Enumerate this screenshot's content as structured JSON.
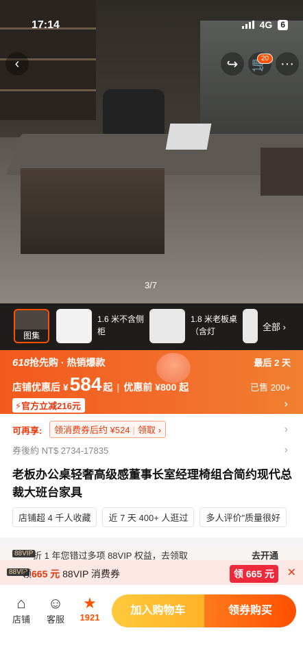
{
  "status": {
    "time": "17:14",
    "network": "4G",
    "battery": "6"
  },
  "header": {
    "cart_count": "20"
  },
  "gallery": {
    "indicator": "3/7"
  },
  "thumbnails": [
    {
      "label": "图集"
    },
    {
      "label": "1.6 米不含侧柜"
    },
    {
      "label": "1.8 米老板桌（含灯"
    },
    {
      "label": ""
    }
  ],
  "all_label": "全部",
  "promo": {
    "event": "618",
    "event_text": "抢先购 · 热销爆款",
    "last_days": "最后 2 天",
    "price_prefix": "店铺优惠后 ¥",
    "price": "584",
    "price_suffix": "起",
    "before": "优惠前 ¥800 起",
    "sold": "已售 200+",
    "official": "官方立减216元"
  },
  "coupon": {
    "again_label": "可再享:",
    "coupon_text": "领消费券后约 ¥524",
    "claim": "领取",
    "nt_price": "券後約 NT$ 2734-17835"
  },
  "product": {
    "title": "老板办公桌轻奢高级感董事长室经理椅组合简约现代总裁大班台家具",
    "tags": [
      "店铺超 4 千人收藏",
      "近 7 天 400+ 人逛过",
      "多人评价\"质量很好"
    ]
  },
  "vip_row": {
    "tag": "88VIP",
    "text": "折 1 年您错过多项 88VIP 权益，去领取",
    "action": "去开通"
  },
  "vip_bar": {
    "tag": "88VIP",
    "prefix": "领",
    "amount": "665 元",
    "suffix": " 88VIP 消费券",
    "button": "领 665 元"
  },
  "bottom": {
    "store": "店铺",
    "service": "客服",
    "fav_count": "1921",
    "add_cart": "加入购物车",
    "buy": "领券购买"
  }
}
